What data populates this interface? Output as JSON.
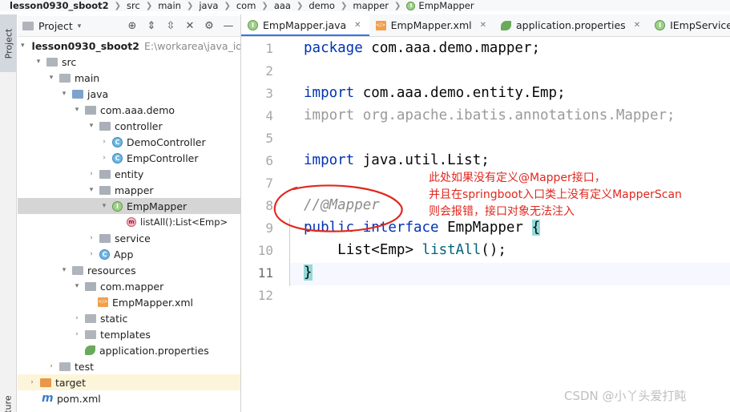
{
  "breadcrumb": [
    {
      "label": "lesson0930_sboot2"
    },
    {
      "label": "src"
    },
    {
      "label": "main"
    },
    {
      "label": "java"
    },
    {
      "label": "com"
    },
    {
      "label": "aaa"
    },
    {
      "label": "demo"
    },
    {
      "label": "mapper"
    },
    {
      "label": "EmpMapper"
    }
  ],
  "tool_strip": {
    "project_label": "Project",
    "structure_label": "cture"
  },
  "project_panel": {
    "title": "Project",
    "icons": [
      "target-icon",
      "collapse-icon",
      "expand-icon",
      "close-icon",
      "gear-icon",
      "minimize-icon"
    ]
  },
  "tree": [
    {
      "label": "lesson0930_sboot2",
      "extra": "E:\\workarea\\java_idea",
      "icon": "folder-icon"
    },
    {
      "label": "src",
      "icon": "folder-icon"
    },
    {
      "label": "main",
      "icon": "folder-icon"
    },
    {
      "label": "java",
      "icon": "folder-icon"
    },
    {
      "label": "com.aaa.demo",
      "icon": "package-icon"
    },
    {
      "label": "controller",
      "icon": "package-icon"
    },
    {
      "label": "DemoController",
      "icon": "class-icon"
    },
    {
      "label": "EmpController",
      "icon": "class-icon"
    },
    {
      "label": "entity",
      "icon": "package-icon"
    },
    {
      "label": "mapper",
      "icon": "package-icon"
    },
    {
      "label": "EmpMapper",
      "icon": "interface-icon"
    },
    {
      "label": "listAll():List<Emp>",
      "icon": "method-icon"
    },
    {
      "label": "service",
      "icon": "package-icon"
    },
    {
      "label": "App",
      "icon": "class-icon"
    },
    {
      "label": "resources",
      "icon": "folder-icon"
    },
    {
      "label": "com.mapper",
      "icon": "package-icon"
    },
    {
      "label": "EmpMapper.xml",
      "icon": "xml-icon"
    },
    {
      "label": "static",
      "icon": "folder-icon"
    },
    {
      "label": "templates",
      "icon": "folder-icon"
    },
    {
      "label": "application.properties",
      "icon": "leaf-icon"
    },
    {
      "label": "test",
      "icon": "folder-icon"
    },
    {
      "label": "target",
      "icon": "folder-icon"
    },
    {
      "label": "pom.xml",
      "icon": "maven-icon"
    }
  ],
  "tabs": [
    {
      "label": "EmpMapper.java",
      "icon": "interface-icon"
    },
    {
      "label": "EmpMapper.xml",
      "icon": "xml-icon"
    },
    {
      "label": "application.properties",
      "icon": "leaf-icon"
    },
    {
      "label": "IEmpService.java",
      "icon": "interface-icon"
    }
  ],
  "editor": {
    "line_numbers": [
      "1",
      "2",
      "3",
      "4",
      "5",
      "6",
      "7",
      "8",
      "9",
      "10",
      "11",
      "12"
    ],
    "current_line": "11",
    "code": {
      "l1_kw": "package",
      "l1_rest": " com.aaa.demo.mapper;",
      "l3_kw": "import",
      "l3_rest": " com.aaa.demo.entity.Emp;",
      "l4": "import org.apache.ibatis.annotations.Mapper;",
      "l6_kw": "import",
      "l6_rest": " java.util.List;",
      "l8": "//@Mapper",
      "l9_kw1": "public",
      "l9_kw2": "interface",
      "l9_name": "EmpMapper",
      "l9_brace": "{",
      "l10_type": "List<Emp>",
      "l10_method": "listAll",
      "l10_tail": "();",
      "l11": "}"
    }
  },
  "annotation": {
    "lines": [
      "此处如果没有定义@Mapper接口，",
      "并且在springboot入口类上没有定义MapperScan",
      "则会报错，接口对象无法注入"
    ],
    "color": "#e0281f"
  },
  "watermark": "CSDN @小丫头爱打盹"
}
